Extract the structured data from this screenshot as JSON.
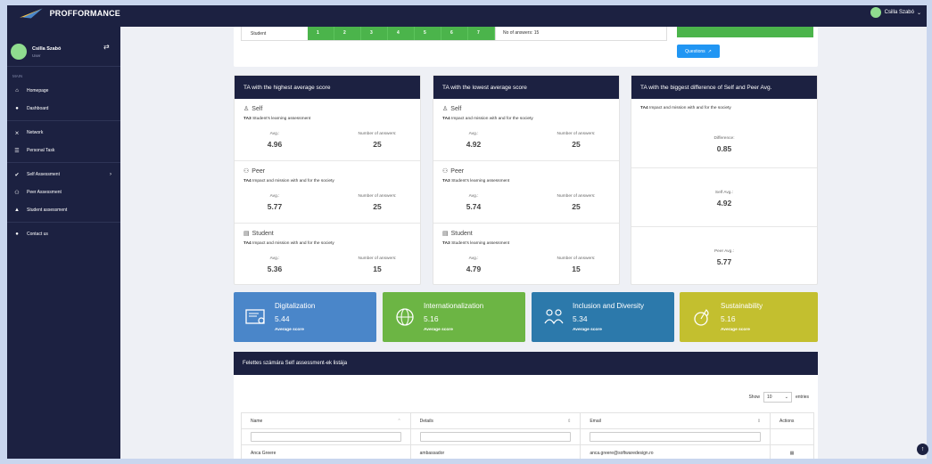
{
  "app": {
    "brand": "PROFFORMANCE"
  },
  "topbar": {
    "user_name": "Csilla Szabó",
    "chevron": "⌄"
  },
  "sidebar": {
    "user_name": "Csilla Szabó",
    "user_role": "User",
    "section": "MAIN",
    "items": [
      {
        "label": "Homepage",
        "icon": "home-icon"
      },
      {
        "label": "Dashboard",
        "icon": "dashboard-icon"
      },
      {
        "label": "Network",
        "icon": "network-icon"
      },
      {
        "label": "Personal Task",
        "icon": "list-icon"
      },
      {
        "label": "Self Assessment",
        "icon": "check-icon"
      },
      {
        "label": "Peer Assessment",
        "icon": "peer-icon"
      },
      {
        "label": "Student assessment",
        "icon": "graduation-icon"
      },
      {
        "label": "Contact us",
        "icon": "chat-icon"
      }
    ]
  },
  "top_card": {
    "strip_label": "Student",
    "scores": [
      "1",
      "2",
      "3",
      "4",
      "5",
      "6",
      "7"
    ],
    "answers": "No of answers: 15",
    "questions_button": "Questions"
  },
  "panels": {
    "highest": {
      "title": "TA with the highest average score",
      "rows": [
        {
          "title": "Self",
          "code": "TA3",
          "desc": "Student's learning assessment",
          "avg_label": "Avg.:",
          "avg": "4.96",
          "count_label": "Number of answers:",
          "count": "25"
        },
        {
          "title": "Peer",
          "code": "TA4",
          "desc": "Impact and mission with and for the society",
          "avg_label": "Avg.:",
          "avg": "5.77",
          "count_label": "Number of answers:",
          "count": "25"
        },
        {
          "title": "Student",
          "code": "TA4",
          "desc": "Impact and mission with and for the society",
          "avg_label": "Avg.:",
          "avg": "5.36",
          "count_label": "Number of answers:",
          "count": "15"
        }
      ]
    },
    "lowest": {
      "title": "TA with the lowest average score",
      "rows": [
        {
          "title": "Self",
          "code": "TA4",
          "desc": "Impact and mission with and for the society",
          "avg_label": "Avg.:",
          "avg": "4.92",
          "count_label": "Number of answers:",
          "count": "25"
        },
        {
          "title": "Peer",
          "code": "TA3",
          "desc": "Student's learning assessment",
          "avg_label": "Avg.:",
          "avg": "5.74",
          "count_label": "Number of answers:",
          "count": "25"
        },
        {
          "title": "Student",
          "code": "TA3",
          "desc": "Student's learning assessment",
          "avg_label": "Avg.:",
          "avg": "4.79",
          "count_label": "Number of answers:",
          "count": "15"
        }
      ]
    },
    "difference": {
      "title": "TA with the biggest difference of Self and Peer Avg.",
      "code": "TA4",
      "desc": "Impact and mission with and for the society",
      "diff_label": "Difference:",
      "diff": "0.85",
      "self_label": "Self Avg.:",
      "self": "4.92",
      "peer_label": "Peer Avg.:",
      "peer": "5.77"
    }
  },
  "topics": [
    {
      "name": "Digitalization",
      "score": "5.44",
      "sub": "Average score",
      "color": "#4a86c9",
      "icon": "certificate-icon"
    },
    {
      "name": "Internationalization",
      "score": "5.16",
      "sub": "Average score",
      "color": "#6cb544",
      "icon": "globe-icon"
    },
    {
      "name": "Inclusion and Diversity",
      "score": "5.34",
      "sub": "Average score",
      "color": "#2c79ab",
      "icon": "people-icon"
    },
    {
      "name": "Sustainability",
      "score": "5.16",
      "sub": "Average score",
      "color": "#c3bf2f",
      "icon": "sustainability-icon"
    }
  ],
  "list": {
    "title": "Felettes számára Self assessment-ek listája",
    "show": "Show",
    "page_size": "10",
    "entries": "entries",
    "columns": [
      "Name",
      "Details",
      "Email",
      "Actions"
    ],
    "rows": [
      {
        "name": "Anca Greere",
        "details": "ambassador",
        "email": "anca.greere@softwaredesign.ro"
      }
    ]
  }
}
